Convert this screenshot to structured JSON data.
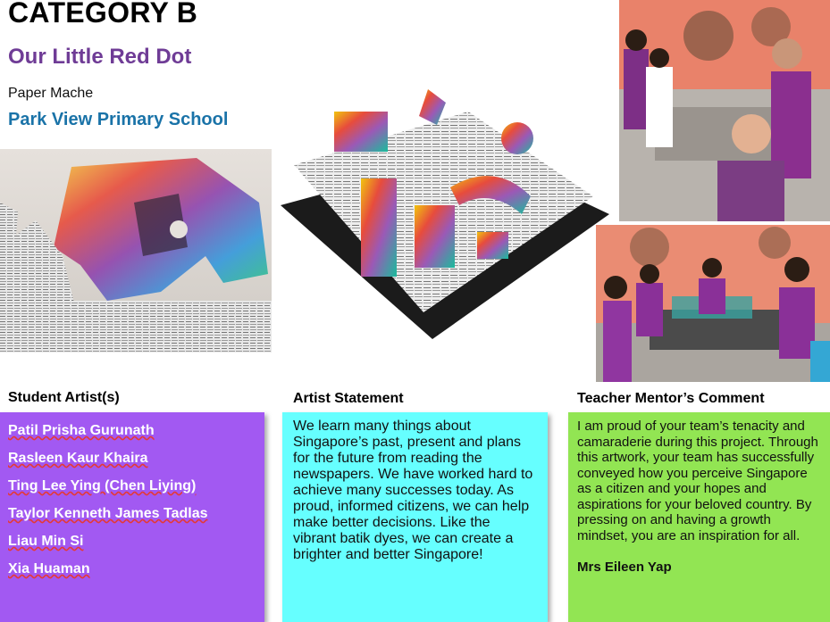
{
  "header": {
    "category": "CATEGORY B",
    "title": "Our Little Red Dot",
    "medium": "Paper Mache",
    "school": "Park View Primary School"
  },
  "sections": {
    "artists_heading": "Student Artist(s)",
    "statement_heading": "Artist Statement",
    "comment_heading": "Teacher Mentor’s Comment"
  },
  "artists": [
    "Patil Prisha Gurunath",
    "Rasleen Kaur Khaira",
    "Ting Lee Ying (Chen Liying)",
    "Taylor Kenneth James Tadlas",
    "Liau Min Si",
    "Xia Huaman"
  ],
  "statement": "We learn many things about Singapore’s past, present and plans for the future from reading the newspapers.  We have worked hard to achieve many successes today.  As proud, informed citizens, we can help make better decisions. Like the vibrant batik dyes, we can create a brighter and better Singapore!",
  "comment": "I am proud of your team’s tenacity and camaraderie during this project. Through this artwork, your team has successfully conveyed how you perceive Singapore as a citizen and your hopes and aspirations for your beloved country. By pressing on and having a growth mindset, you are an inspiration for all.",
  "mentor": "Mrs Eileen Yap",
  "colors": {
    "title": "#6f3c96",
    "school": "#1a73a8",
    "artists_panel": "#a259f2",
    "statement_panel": "#66ffff",
    "comment_panel": "#92e553"
  },
  "images": [
    "sculpture-closeup-photo",
    "artwork-main-photo",
    "students-classroom-photo",
    "students-group-photo"
  ]
}
